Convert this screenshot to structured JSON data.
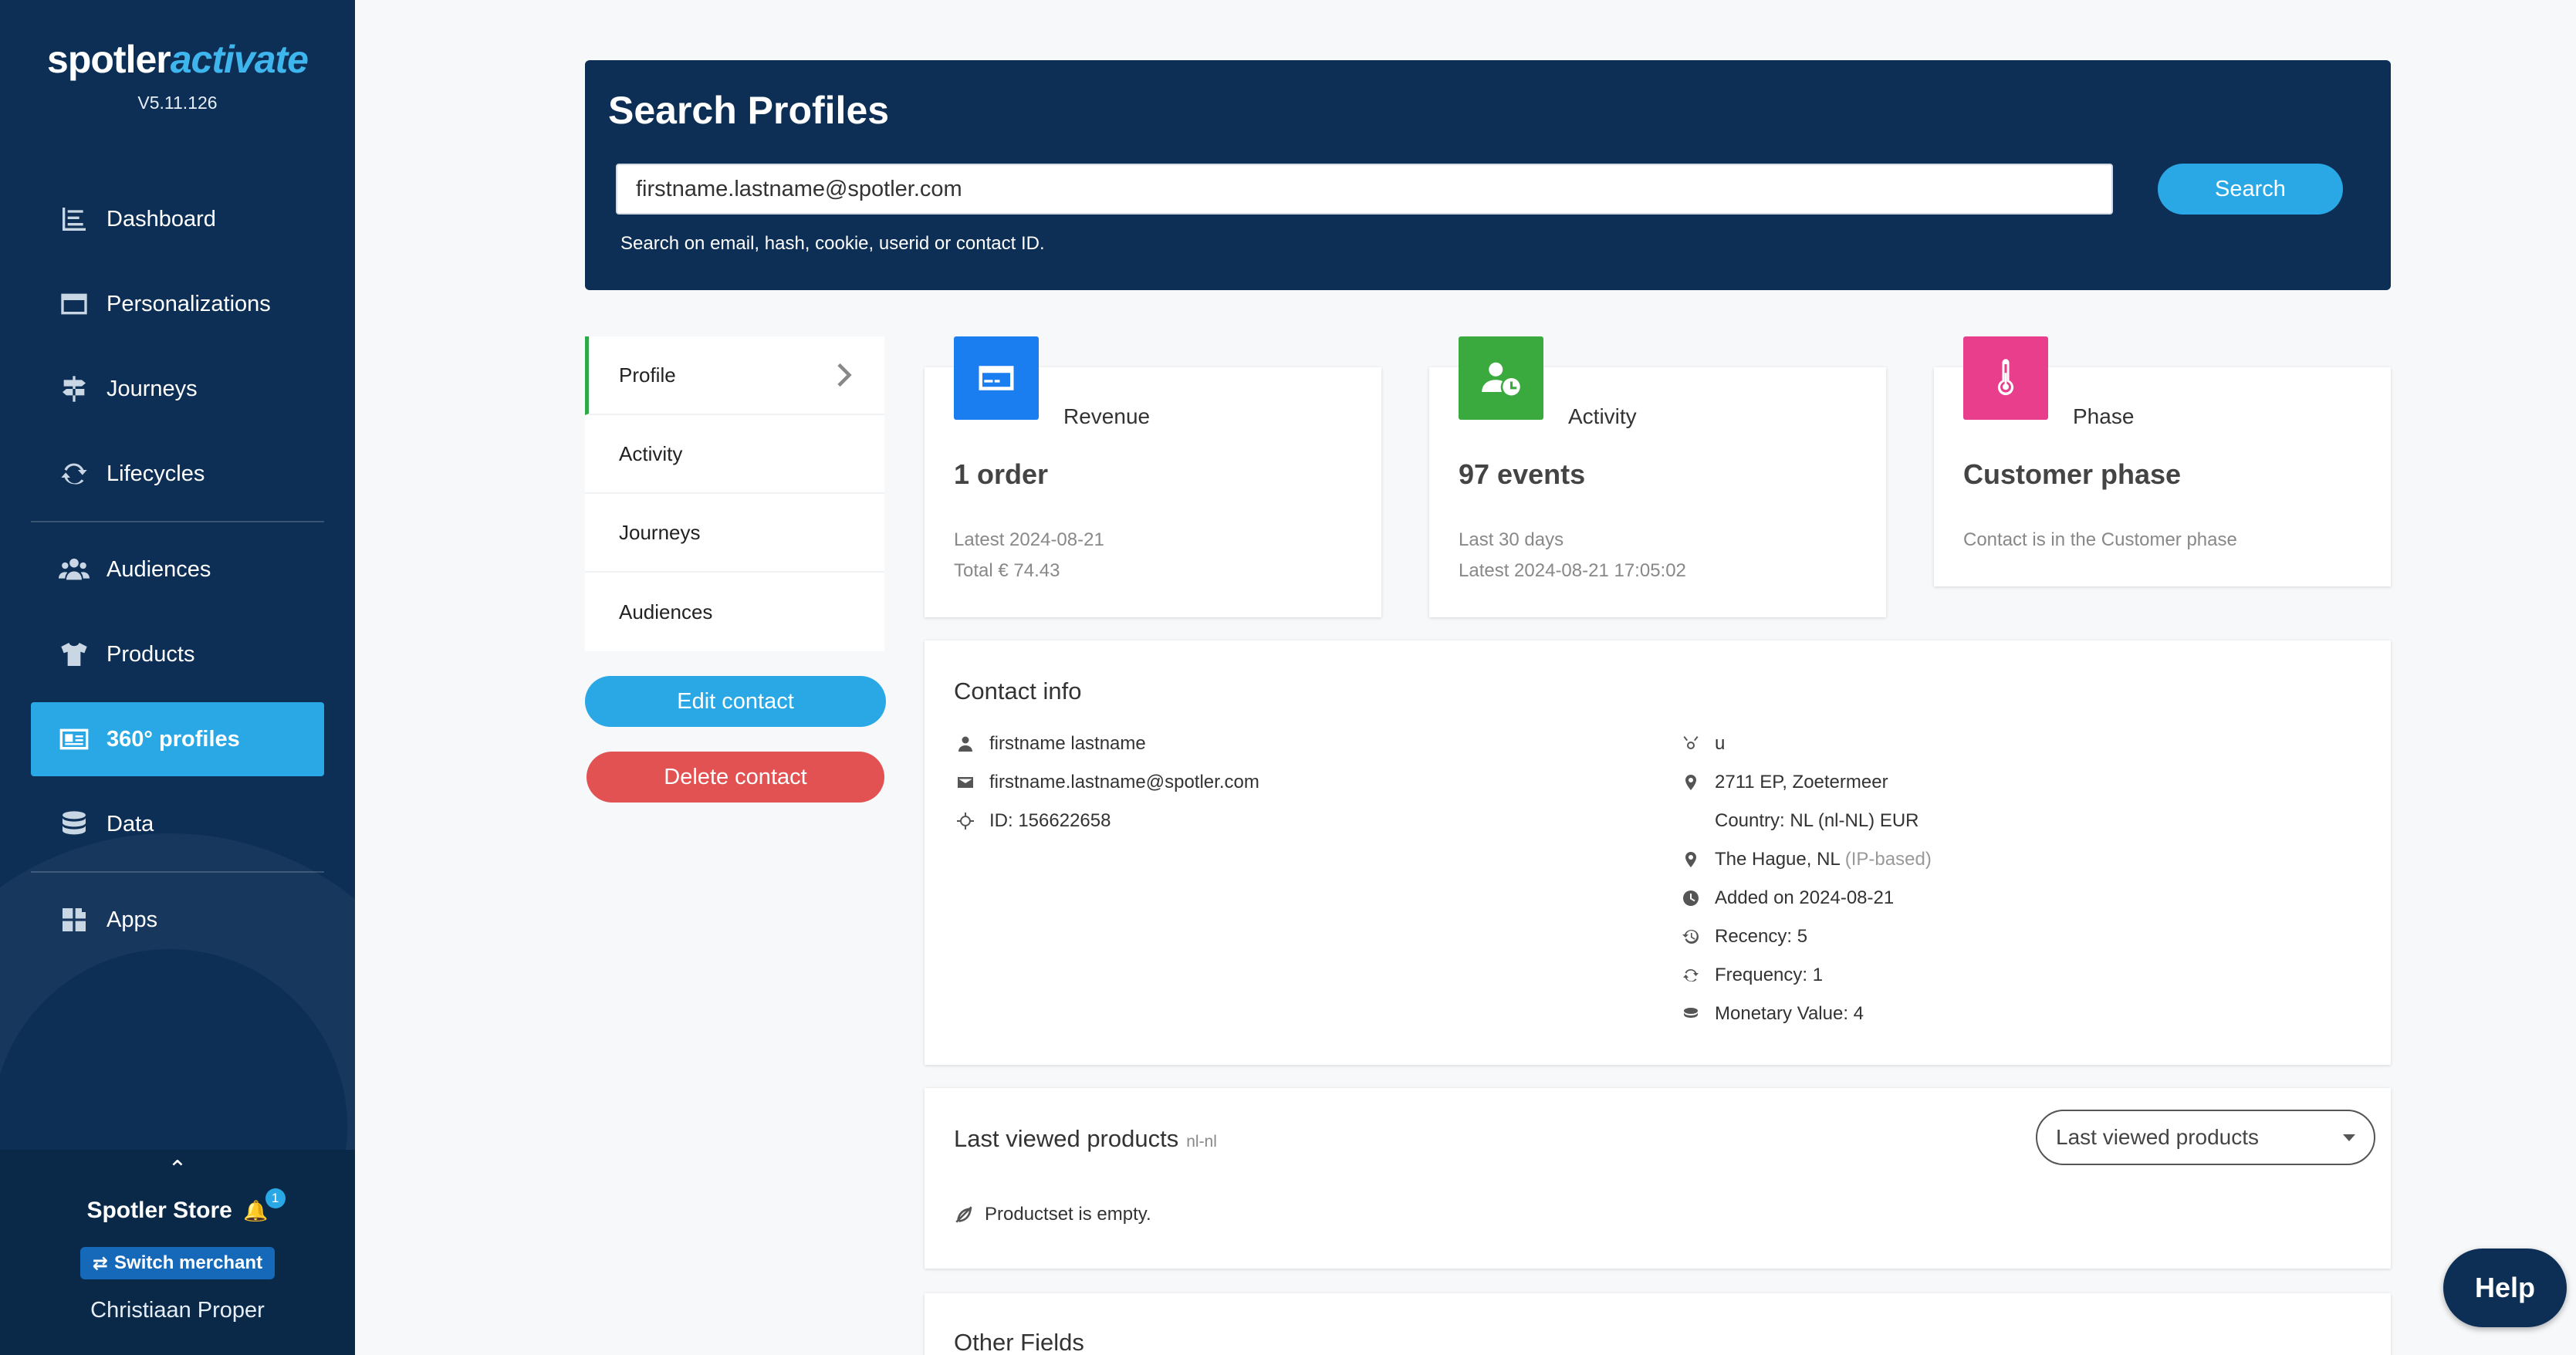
{
  "app": {
    "logo_part1": "spotler",
    "logo_part2": "activate",
    "version": "V5.11.126"
  },
  "sidebar": {
    "items": [
      {
        "label": "Dashboard",
        "icon": "dashboard-icon"
      },
      {
        "label": "Personalizations",
        "icon": "browser-window-icon"
      },
      {
        "label": "Journeys",
        "icon": "signpost-icon"
      },
      {
        "label": "Lifecycles",
        "icon": "refresh-cycle-icon"
      },
      {
        "label": "Audiences",
        "icon": "users-group-icon"
      },
      {
        "label": "Products",
        "icon": "tshirt-icon"
      },
      {
        "label": "360° profiles",
        "icon": "id-card-icon"
      },
      {
        "label": "Data",
        "icon": "database-icon"
      },
      {
        "label": "Apps",
        "icon": "puzzle-apps-icon"
      }
    ],
    "active_item": "360° profiles"
  },
  "merchant": {
    "store_name": "Spotler Store",
    "notification_count": "1",
    "switch_label": "Switch merchant",
    "user_name": "Christiaan Proper"
  },
  "search": {
    "title": "Search Profiles",
    "value": "firstname.lastname@spotler.com",
    "button_label": "Search",
    "hint": "Search on email, hash, cookie, userid or contact ID."
  },
  "tabs": [
    {
      "label": "Profile",
      "active": true
    },
    {
      "label": "Activity",
      "active": false
    },
    {
      "label": "Journeys",
      "active": false
    },
    {
      "label": "Audiences",
      "active": false
    }
  ],
  "actions": {
    "edit_label": "Edit contact",
    "delete_label": "Delete contact"
  },
  "stats": {
    "revenue": {
      "label": "Revenue",
      "value": "1 order",
      "sub1": "Latest 2024-08-21",
      "sub2": "Total € 74.43",
      "color": "#1a7df0"
    },
    "activity": {
      "label": "Activity",
      "value": "97 events",
      "sub1": "Last 30 days",
      "sub2": "Latest 2024-08-21 17:05:02",
      "color": "#3aaa3f"
    },
    "phase": {
      "label": "Phase",
      "value": "Customer phase",
      "sub1": "Contact is in the Customer phase",
      "color": "#e83e8c"
    }
  },
  "contact_info": {
    "title": "Contact info",
    "left": [
      {
        "icon": "person-icon",
        "text": "firstname lastname"
      },
      {
        "icon": "envelope-icon",
        "text": "firstname.lastname@spotler.com"
      },
      {
        "icon": "crosshair-icon",
        "text": "ID: 156622658"
      }
    ],
    "right": [
      {
        "icon": "gender-icon",
        "text": "u"
      },
      {
        "icon": "location-pin-icon",
        "text": "2711 EP, Zoetermeer"
      },
      {
        "icon": "",
        "text": "Country: NL (nl-NL) EUR"
      },
      {
        "icon": "location-pin-icon",
        "text": "The Hague, NL",
        "muted": "(IP-based)"
      },
      {
        "icon": "clock-icon",
        "text": "Added on 2024-08-21"
      },
      {
        "icon": "history-icon",
        "text": "Recency: 5"
      },
      {
        "icon": "sync-icon",
        "text": "Frequency: 1"
      },
      {
        "icon": "coins-icon",
        "text": "Monetary Value: 4"
      }
    ]
  },
  "last_viewed": {
    "title": "Last viewed products",
    "locale": "nl-nl",
    "select_value": "Last viewed products",
    "empty_text": "Productset is empty."
  },
  "other_fields": {
    "title": "Other Fields"
  },
  "help": {
    "label": "Help"
  }
}
